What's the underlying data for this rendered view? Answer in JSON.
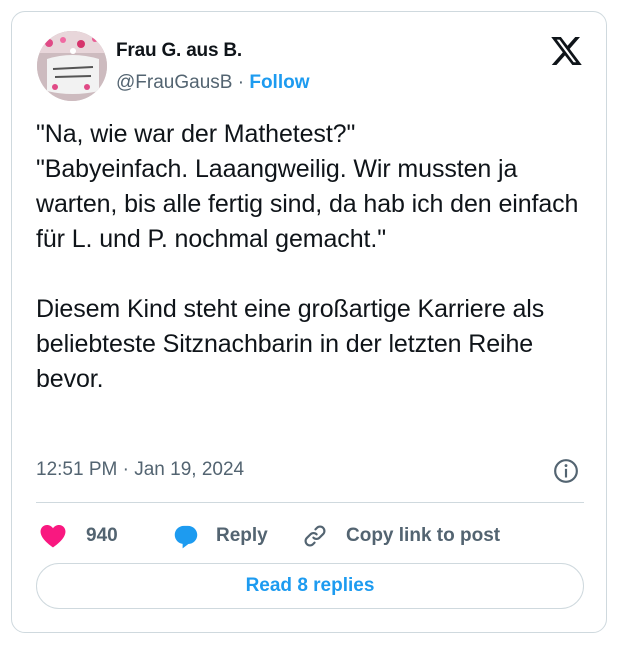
{
  "author": {
    "display_name": "Frau G. aus B.",
    "handle": "@FrauGausB",
    "separator": "·",
    "follow_label": "Follow"
  },
  "tweet": {
    "text": "\"Na, wie war der Mathetest?\"\n\"Babyeinfach. Laaangweilig. Wir mussten ja warten, bis alle fertig sind, da hab ich den einfach für L. und P. nochmal gemacht.\"\n\nDiesem Kind steht eine großartige Karriere als beliebteste Sitznachbarin in der letzten Reihe bevor.",
    "timestamp": "12:51 PM · Jan 19, 2024"
  },
  "actions": {
    "like_count": "940",
    "reply_label": "Reply",
    "copy_link_label": "Copy link to post"
  },
  "footer": {
    "read_replies_label": "Read 8 replies"
  },
  "colors": {
    "accent": "#1d9bf0",
    "like": "#f91880",
    "text": "#0f1419",
    "secondary": "#536471",
    "border": "#cfd9de"
  },
  "icons": [
    "x-logo-icon",
    "info-icon",
    "heart-icon",
    "reply-bubble-icon",
    "link-icon"
  ]
}
